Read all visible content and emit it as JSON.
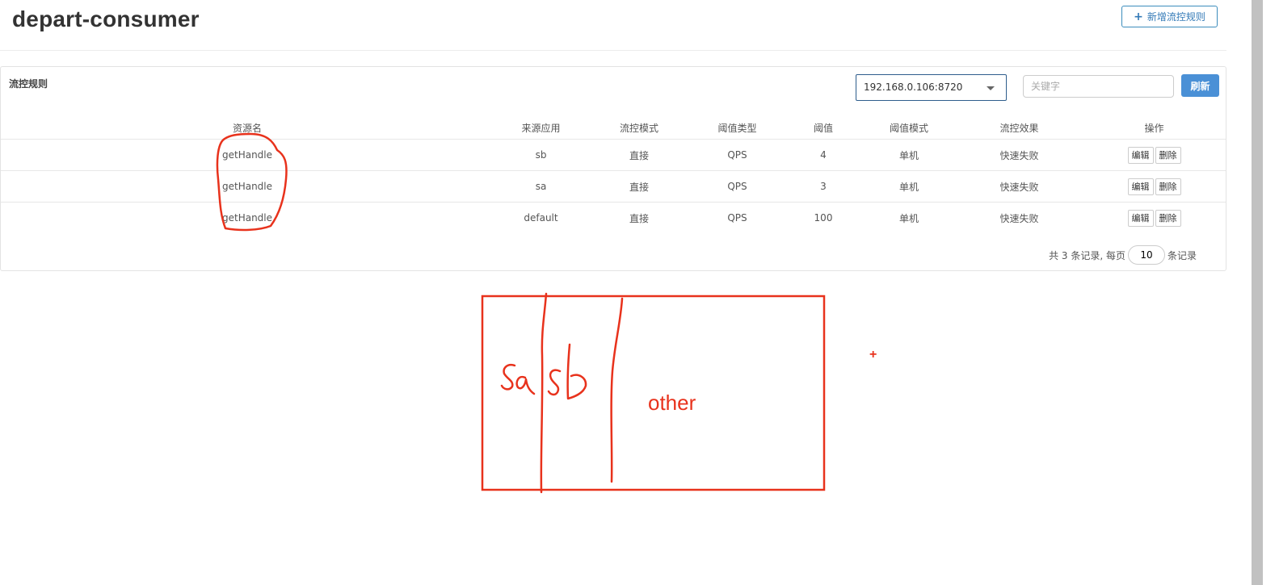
{
  "header": {
    "title": "depart-consumer",
    "add_button_label": "新增流控规则",
    "add_button_icon": "plus-icon"
  },
  "panel": {
    "title": "流控规则",
    "machine_select_value": "192.168.0.106:8720",
    "search_placeholder": "关键字",
    "refresh_label": "刷新"
  },
  "table": {
    "columns": [
      "资源名",
      "来源应用",
      "流控模式",
      "阈值类型",
      "阈值",
      "阈值模式",
      "流控效果",
      "操作"
    ],
    "rows": [
      {
        "resource": "getHandle",
        "limit_app": "sb",
        "strategy": "直接",
        "grade": "QPS",
        "count": "4",
        "cluster_mode": "单机",
        "control_behavior": "快速失败"
      },
      {
        "resource": "getHandle",
        "limit_app": "sa",
        "strategy": "直接",
        "grade": "QPS",
        "count": "3",
        "cluster_mode": "单机",
        "control_behavior": "快速失败"
      },
      {
        "resource": "getHandle",
        "limit_app": "default",
        "strategy": "直接",
        "grade": "QPS",
        "count": "100",
        "cluster_mode": "单机",
        "control_behavior": "快速失败"
      }
    ],
    "edit_label": "编辑",
    "delete_label": "删除"
  },
  "pagination": {
    "total_text": "共 3 条记录, 每页",
    "page_size": "10",
    "suffix_text": "条记录"
  },
  "annotation": {
    "color": "#e8321c",
    "handwritten_labels": [
      "sa",
      "sb"
    ],
    "other_label": "other",
    "plus_mark": "+"
  },
  "colors": {
    "primary": "#4a90d6",
    "link": "#337ab7",
    "annotation": "#e8321c"
  }
}
